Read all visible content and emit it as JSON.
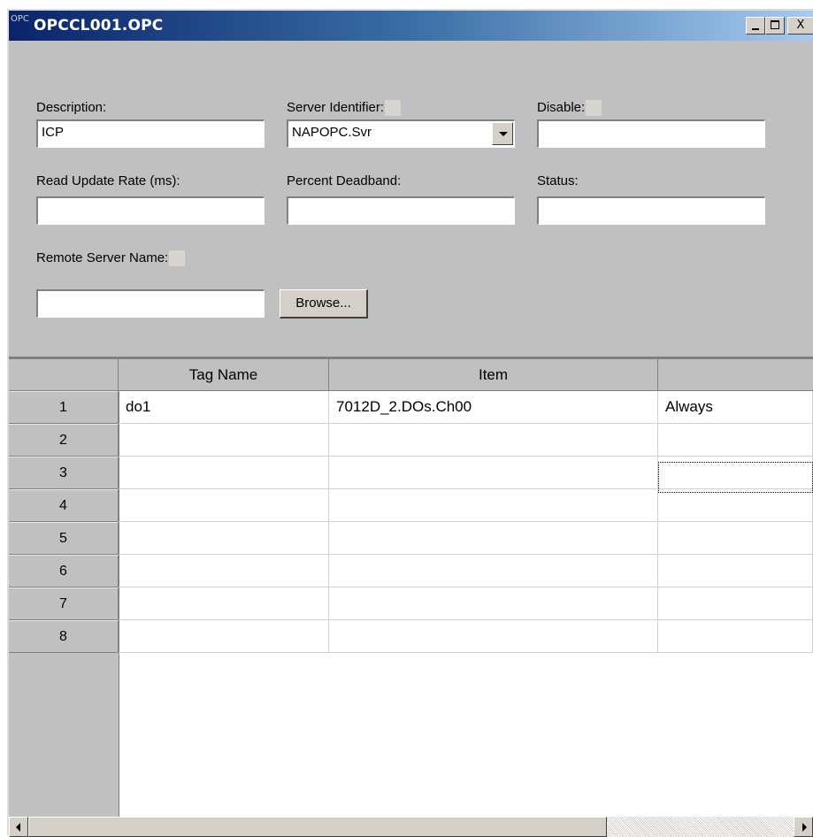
{
  "window": {
    "title": "OPCCL001.OPC",
    "app_icon_text": "OPC",
    "minimize_icon": "minimize-icon",
    "maximize_icon": "maximize-icon",
    "close_label": "X"
  },
  "form": {
    "description_label": "Description:",
    "description_value": "ICP",
    "server_identifier_label": "Server Identifier:",
    "server_identifier_value": "NAPOPC.Svr",
    "disable_label": "Disable:",
    "disable_value": "",
    "read_update_rate_label": "Read Update Rate (ms):",
    "read_update_rate_value": "",
    "percent_deadband_label": "Percent Deadband:",
    "percent_deadband_value": "",
    "status_label": "Status:",
    "status_value": "",
    "remote_server_name_label": "Remote Server Name:",
    "remote_server_name_value": "",
    "browse_label": "Browse..."
  },
  "grid": {
    "columns": [
      "Tag Name",
      "Item",
      ""
    ],
    "rows": [
      {
        "num": "1",
        "tag": "do1",
        "item": "7012D_2.DOs.Ch00",
        "extra": "Always"
      },
      {
        "num": "2",
        "tag": "",
        "item": "",
        "extra": ""
      },
      {
        "num": "3",
        "tag": "",
        "item": "",
        "extra": ""
      },
      {
        "num": "4",
        "tag": "",
        "item": "",
        "extra": ""
      },
      {
        "num": "5",
        "tag": "",
        "item": "",
        "extra": ""
      },
      {
        "num": "6",
        "tag": "",
        "item": "",
        "extra": ""
      },
      {
        "num": "7",
        "tag": "",
        "item": "",
        "extra": ""
      },
      {
        "num": "8",
        "tag": "",
        "item": "",
        "extra": ""
      }
    ]
  },
  "scrollbar": {
    "left_icon": "arrow-left-icon",
    "right_icon": "arrow-right-icon"
  }
}
